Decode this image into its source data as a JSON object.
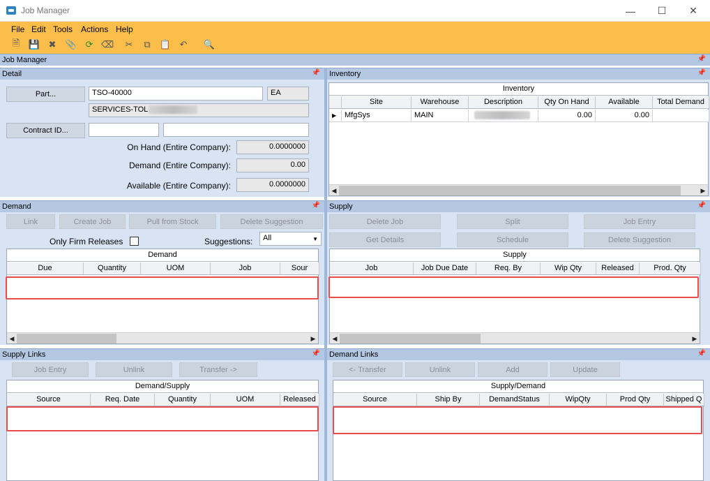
{
  "window": {
    "title": "Job Manager",
    "min_icon": "minimize-icon",
    "max_icon": "maximize-icon",
    "close_icon": "close-icon"
  },
  "menu": [
    "File",
    "Edit",
    "Tools",
    "Actions",
    "Help"
  ],
  "toolbar_icons": [
    "new-icon",
    "save-icon",
    "delete-icon",
    "attach-icon",
    "refresh-icon",
    "clear-icon",
    "cut-icon",
    "copy-icon",
    "paste-icon",
    "undo-icon",
    "search-icon"
  ],
  "colors": {
    "menubar": "#fbbe4b",
    "panel": "#d8e4f4",
    "panel_header": "#b4c8e4",
    "highlight": "#e84c4c"
  },
  "job_manager_bar": "Job Manager",
  "detail": {
    "title": "Detail",
    "part_button": "Part...",
    "part_value": "TSO-40000",
    "uom_value": "EA",
    "part_desc": "SERVICES-TOL",
    "contract_button": "Contract ID...",
    "contract_value": "",
    "contract_desc": "",
    "on_hand_label": "On Hand (Entire Company):",
    "on_hand_value": "0.0000000",
    "demand_label": "Demand (Entire Company):",
    "demand_value": "0.00",
    "available_label": "Available (Entire Company):",
    "available_value": "0.0000000"
  },
  "inventory": {
    "title": "Inventory",
    "grid_title": "Inventory",
    "columns": [
      "Site",
      "Warehouse",
      "Description",
      "Qty On Hand",
      "Available",
      "Total Demand"
    ],
    "rows": [
      {
        "site": "MfgSys",
        "warehouse": "MAIN",
        "description": "",
        "qty_on_hand": "0.00",
        "available": "0.00",
        "total_demand": ""
      }
    ]
  },
  "demand": {
    "title": "Demand",
    "buttons": [
      "Link",
      "Create Job",
      "Pull from Stock",
      "Delete Suggestion"
    ],
    "firm_label": "Only Firm Releases",
    "suggestions_label": "Suggestions:",
    "suggestions_value": "All",
    "grid_title": "Demand",
    "columns": [
      "Due",
      "Quantity",
      "UOM",
      "Job",
      "Sour"
    ]
  },
  "supply": {
    "title": "Supply",
    "buttons_row1": [
      "Delete Job",
      "Split",
      "Job Entry"
    ],
    "buttons_row2": [
      "Get Details",
      "Schedule",
      "Delete Suggestion"
    ],
    "grid_title": "Supply",
    "columns": [
      "Job",
      "Job Due Date",
      "Req. By",
      "Wip Qty",
      "Released",
      "Prod. Qty"
    ]
  },
  "supply_links": {
    "title": "Supply Links",
    "buttons": [
      "Job Entry",
      "Unlink",
      "Transfer ->"
    ],
    "grid_title": "Demand/Supply",
    "columns": [
      "Source",
      "Req. Date",
      "Quantity",
      "UOM",
      "Released"
    ]
  },
  "demand_links": {
    "title": "Demand Links",
    "buttons": [
      "<- Transfer",
      "Unlink",
      "Add",
      "Update"
    ],
    "grid_title": "Supply/Demand",
    "columns": [
      "Source",
      "Ship By",
      "DemandStatus",
      "WipQty",
      "Prod Qty",
      "Shipped Q"
    ]
  }
}
